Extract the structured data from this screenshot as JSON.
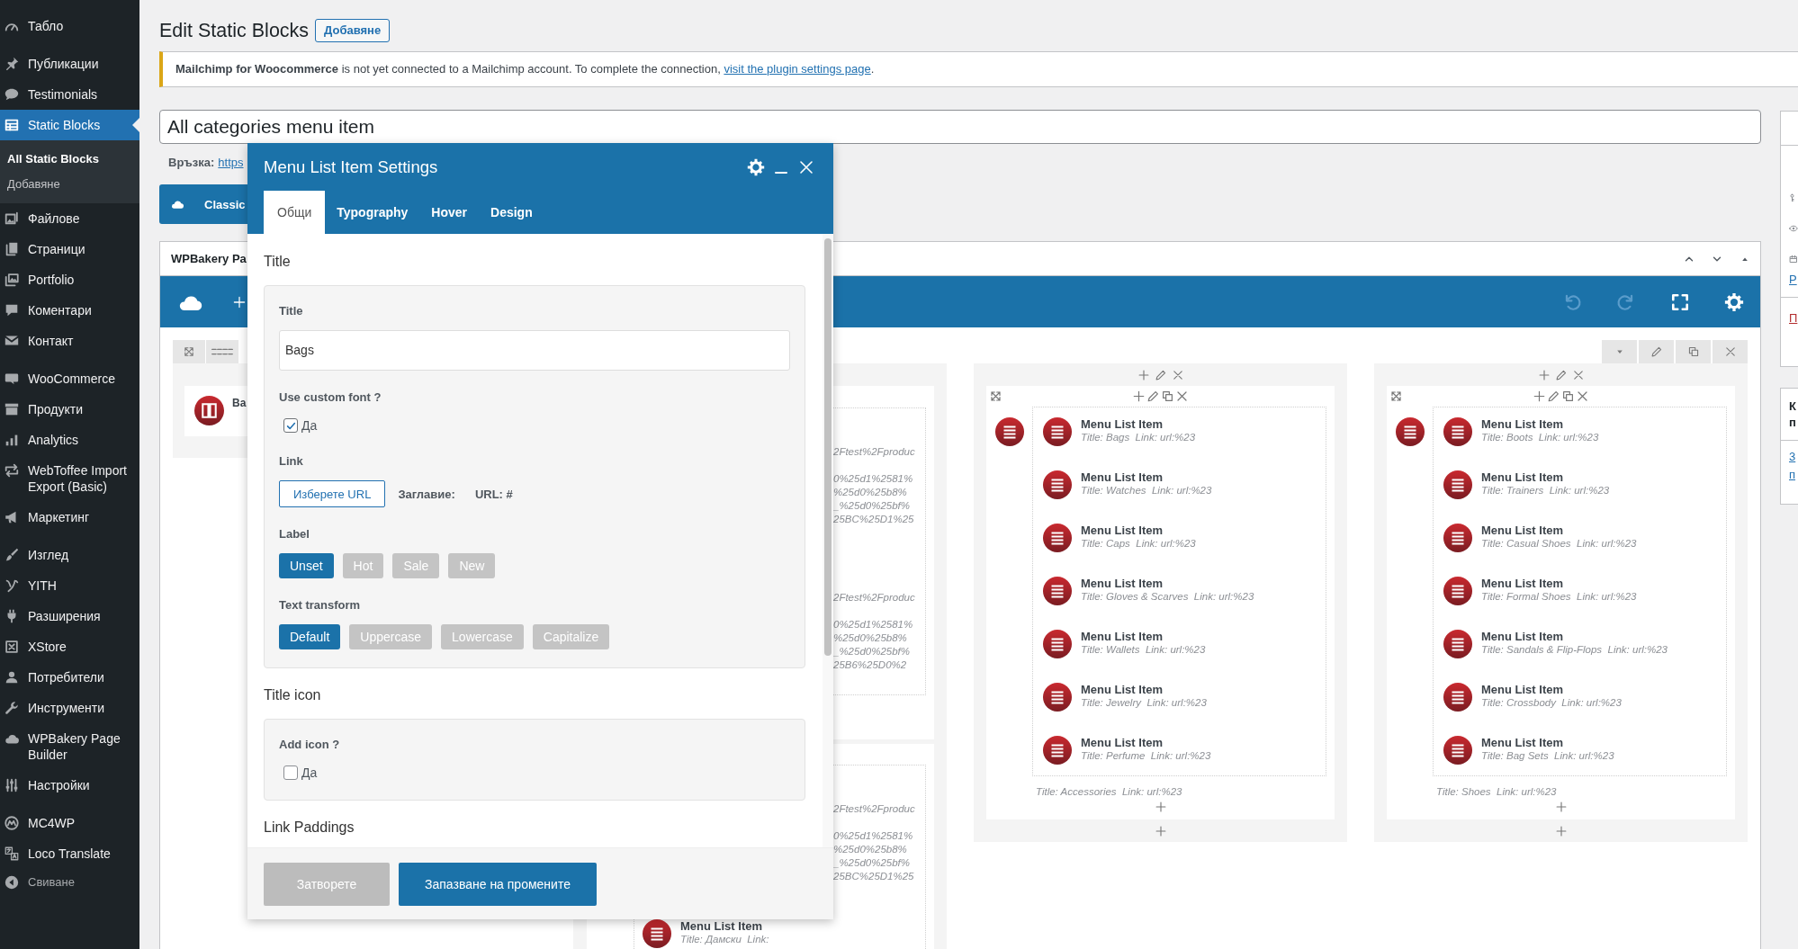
{
  "sidebar": {
    "groups": [
      {
        "items": [
          {
            "label": "Табло",
            "selected": false
          }
        ]
      },
      {
        "items": [
          {
            "label": "Публикации",
            "selected": false
          },
          {
            "label": "Testimonials",
            "selected": false
          },
          {
            "label": "Static Blocks",
            "selected": true,
            "children": [
              {
                "label": "All Static Blocks",
                "selected": true
              },
              {
                "label": "Добавяне",
                "selected": false
              }
            ]
          },
          {
            "label": "Файлове",
            "selected": false
          },
          {
            "label": "Страници",
            "selected": false
          },
          {
            "label": "Portfolio",
            "selected": false
          },
          {
            "label": "Коментари",
            "selected": false
          },
          {
            "label": "Контакт",
            "selected": false
          }
        ]
      },
      {
        "items": [
          {
            "label": "WooCommerce",
            "selected": false
          },
          {
            "label": "Продукти",
            "selected": false
          },
          {
            "label": "Analytics",
            "selected": false
          },
          {
            "label": "WebToffee Import Export (Basic)",
            "selected": false
          },
          {
            "label": "Маркетинг",
            "selected": false
          }
        ]
      },
      {
        "items": [
          {
            "label": "Изглед",
            "selected": false
          },
          {
            "label": "YITH",
            "selected": false
          },
          {
            "label": "Разширения",
            "selected": false
          },
          {
            "label": "XStore",
            "selected": false
          },
          {
            "label": "Потребители",
            "selected": false
          },
          {
            "label": "Инструменти",
            "selected": false
          },
          {
            "label": "WPBakery Page Builder",
            "selected": false
          },
          {
            "label": "Настройки",
            "selected": false
          }
        ]
      },
      {
        "items": [
          {
            "label": "MC4WP",
            "selected": false
          },
          {
            "label": "Loco Translate",
            "selected": false
          }
        ]
      }
    ],
    "collapse": "Свиване"
  },
  "header": {
    "title": "Edit Static Blocks",
    "add_button": "Добавяне"
  },
  "notice": {
    "text": "**Mailchimp for Woocommerce** is not yet connected to a Mailchimp account. To complete the connection,",
    "link": "visit the plugin settings page",
    "end": "."
  },
  "post_title": {
    "value": "All categories menu item"
  },
  "permalink": {
    "label": "Връзка:",
    "url": "https"
  },
  "mode_button": {
    "label": "Classic"
  },
  "builder": {
    "title": "WPBakery Pa",
    "columns": [
      {
        "kind": "elements",
        "elements": [
          {
            "title": "Ba"
          }
        ]
      },
      {
        "kind": "clipped",
        "boxes": [
          {
            "fragments": [
              {
                "head": "2Ftest%2Fproduc",
                "lines": [
                  "0%25d1%2581%",
                  "%25d0%25b8%",
                  "_%25d0%25bf%",
                  "25BC%25D1%25"
                ]
              },
              {
                "head": "2Ftest%2Fproduc",
                "lines": [
                  "0%25d1%2581%",
                  "%25d0%25b8%",
                  "_%25d0%25bf%",
                  "25B6%25D0%2"
                ]
              }
            ]
          },
          {
            "fragments": [
              {
                "head": "2Ftest%2Fproduc",
                "lines": [
                  "0%25d1%2581%",
                  "%25d0%25b8%",
                  "_%25d0%25bf%",
                  "25BC%25D1%25"
                ]
              }
            ],
            "items": [
              {
                "title": "Menu List Item",
                "params": "Title: Дамски  Link:"
              }
            ]
          }
        ]
      },
      {
        "kind": "inner_row",
        "items": [
          {
            "title": "Menu List Item",
            "params": "Title: Bags  Link: url:%23"
          },
          {
            "title": "Menu List Item",
            "params": "Title: Watches  Link: url:%23"
          },
          {
            "title": "Menu List Item",
            "params": "Title: Caps  Link: url:%23"
          },
          {
            "title": "Menu List Item",
            "params": "Title: Gloves & Scarves  Link: url:%23"
          },
          {
            "title": "Menu List Item",
            "params": "Title: Wallets  Link: url:%23"
          },
          {
            "title": "Menu List Item",
            "params": "Title: Jewelry  Link: url:%23"
          },
          {
            "title": "Menu List Item",
            "params": "Title: Perfume  Link: url:%23"
          }
        ],
        "footer": "Title: Accessories  Link: url:%23"
      },
      {
        "kind": "inner_row",
        "items": [
          {
            "title": "Menu List Item",
            "params": "Title: Boots  Link: url:%23"
          },
          {
            "title": "Menu List Item",
            "params": "Title: Trainers  Link: url:%23"
          },
          {
            "title": "Menu List Item",
            "params": "Title: Casual Shoes  Link: url:%23"
          },
          {
            "title": "Menu List Item",
            "params": "Title: Formal Shoes  Link: url:%23"
          },
          {
            "title": "Menu List Item",
            "params": "Title: Sandals & Flip-Flops  Link: url:%23"
          },
          {
            "title": "Menu List Item",
            "params": "Title: Crossbody  Link: url:%23"
          },
          {
            "title": "Menu List Item",
            "params": "Title: Bag Sets  Link: url:%23"
          }
        ],
        "footer": "Title: Shoes  Link: url:%23"
      }
    ]
  },
  "side_panels": [
    {
      "kind": "publish",
      "link": "P",
      "delete_link": "П"
    },
    {
      "kind": "box",
      "title_lines": [
        "К",
        "п"
      ],
      "links": [
        "3",
        "п"
      ]
    }
  ],
  "settings_modal": {
    "title": "Menu List Item Settings",
    "tabs": [
      {
        "label": "Общи",
        "selected": true
      },
      {
        "label": "Typography",
        "selected": false
      },
      {
        "label": "Hover",
        "selected": false
      },
      {
        "label": "Design",
        "selected": false
      }
    ],
    "sections": [
      {
        "heading": "Title",
        "fields": [
          {
            "kind": "text",
            "label": "Title",
            "value": "Bags"
          },
          {
            "kind": "checkbox",
            "label": "Use custom font ?",
            "option": "Да",
            "checked": true
          },
          {
            "kind": "link",
            "label": "Link",
            "button": "Изберете URL",
            "title_label": "Заглавие:",
            "url": "URL: #"
          },
          {
            "kind": "buttons",
            "label": "Label",
            "options": [
              {
                "label": "Unset",
                "selected": true
              },
              {
                "label": "Hot",
                "selected": false
              },
              {
                "label": "Sale",
                "selected": false
              },
              {
                "label": "New",
                "selected": false
              }
            ]
          },
          {
            "kind": "buttons",
            "label": "Text transform",
            "options": [
              {
                "label": "Default",
                "selected": true
              },
              {
                "label": "Uppercase",
                "selected": false
              },
              {
                "label": "Lowercase",
                "selected": false
              },
              {
                "label": "Capitalize",
                "selected": false
              }
            ]
          }
        ]
      },
      {
        "heading": "Title icon",
        "fields": [
          {
            "kind": "checkbox",
            "label": "Add icon ?",
            "option": "Да",
            "checked": false
          }
        ]
      },
      {
        "heading": "Link Paddings"
      }
    ],
    "buttons": [
      {
        "label": "Затворете",
        "kind": "secondary"
      },
      {
        "label": "Запазване на промените",
        "kind": "primary"
      }
    ]
  }
}
